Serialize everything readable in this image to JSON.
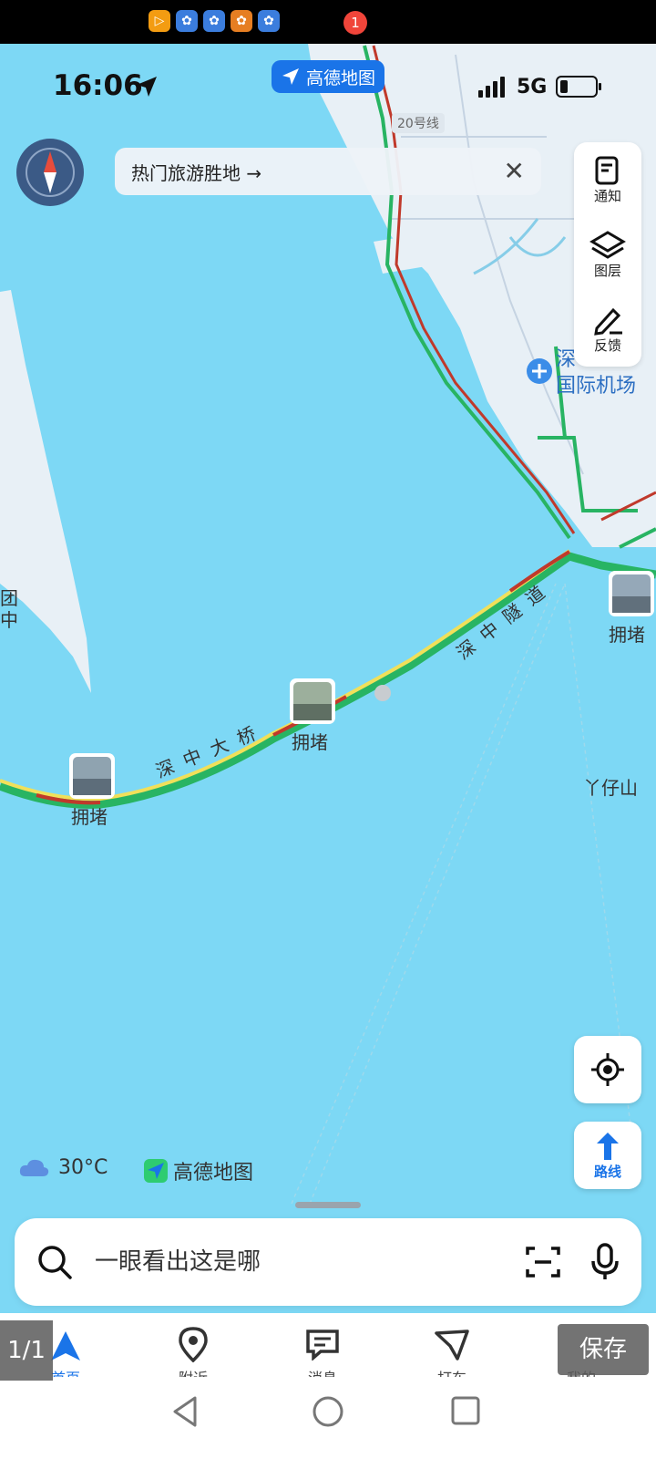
{
  "notification_icons": [
    "video-app-icon",
    "baidu-paw-icon",
    "baidu-paw-icon",
    "taobao-icon",
    "baidu-paw-icon"
  ],
  "status": {
    "time": "16:06",
    "network": "5G"
  },
  "app_badge": "高德地图",
  "hot_spots": {
    "label": "热门旅游胜地 →"
  },
  "right_panel": {
    "notify": "通知",
    "layers": "图层",
    "feedback": "反馈"
  },
  "map": {
    "road_20": "20号线",
    "airport_line1": "深",
    "airport_line2": "国际机场",
    "bridge": "深中大桥",
    "tunnel": "深中隧道",
    "jam_1": "拥堵",
    "jam_2": "拥堵",
    "jam_3": "拥堵",
    "mountain": "丫仔山",
    "left_frag_1": "团",
    "left_frag_2": "中"
  },
  "route_label": "路线",
  "weather": {
    "temp": "30°C"
  },
  "map_logo": "高德地图",
  "search": {
    "placeholder": "一眼看出这是哪"
  },
  "nav": {
    "badge_count": "1",
    "items": [
      "首页",
      "附近",
      "消息",
      "打车",
      "我的"
    ]
  },
  "viewer": {
    "counter": "1/1",
    "save": "保存"
  },
  "colors": {
    "water": "#7dd8f5",
    "land": "#e8f0f6",
    "brand_blue": "#1a74e8",
    "road_green": "#28b463",
    "road_red": "#c0392b",
    "road_yellow": "#f1e05a"
  }
}
